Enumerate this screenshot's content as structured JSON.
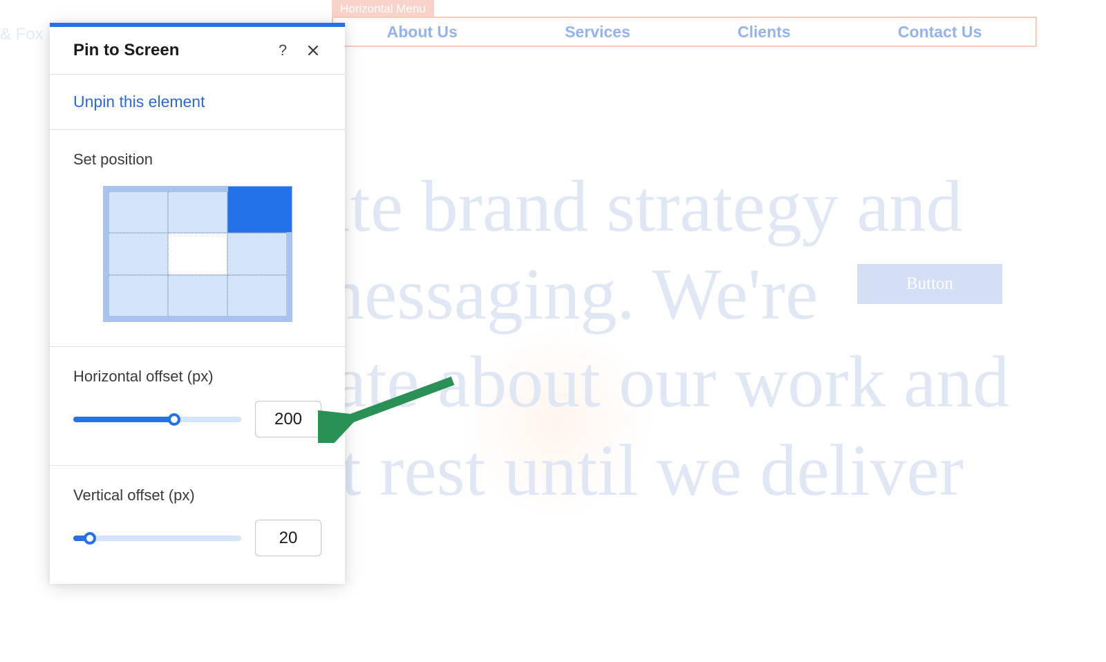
{
  "background": {
    "logo_fragment": "& Fox",
    "nav_label": "Horizontal Menu",
    "nav_items": [
      "About Us",
      "Services",
      "Clients",
      "Contact Us"
    ],
    "heading": "We create brand strategy and visual messaging. We're passionate about our work and we don't rest until we deliver",
    "button_label": "Button"
  },
  "panel": {
    "title": "Pin to Screen",
    "unpin_link": "Unpin this element",
    "set_position_label": "Set position",
    "horizontal": {
      "label": "Horizontal offset (px)",
      "value": "200",
      "fill_pct": 60
    },
    "vertical": {
      "label": "Vertical offset (px)",
      "value": "20",
      "fill_pct": 10
    }
  }
}
